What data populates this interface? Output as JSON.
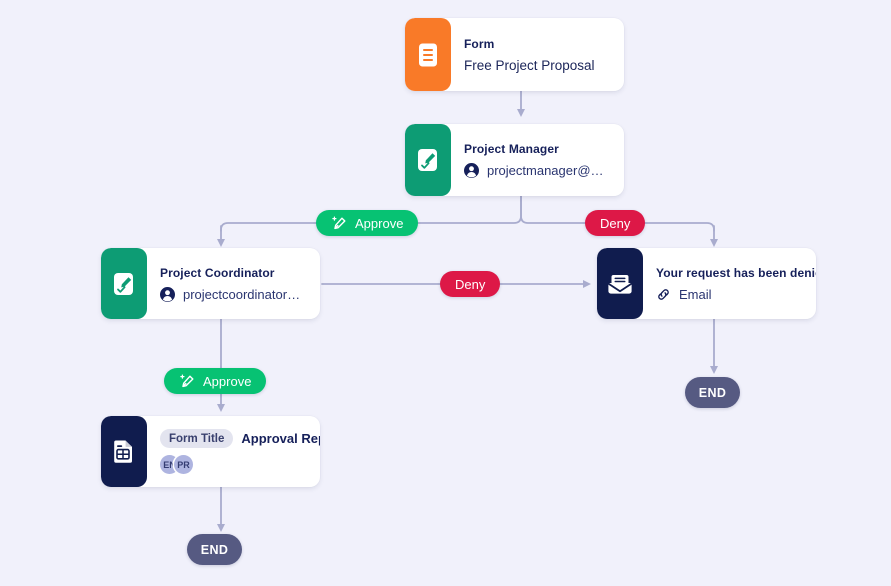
{
  "canvas": {
    "background_color": "#f1f1fb"
  },
  "palette": {
    "form_icon_bg": "#f97a28",
    "approver_icon_bg": "#0d9c74",
    "email_icon_bg": "#101c4e",
    "report_icon_bg": "#101c4e",
    "approve_pill_bg": "#07c273",
    "deny_pill_bg": "#dd1847",
    "end_pill_bg": "#565a82",
    "edge_stroke": "#a9acce",
    "card_bg": "#ffffff",
    "title_text": "#16205a",
    "lang_chip_bg": "#aeb4e0"
  },
  "nodes": {
    "form": {
      "icon": "document-icon",
      "title": "Form",
      "subtitle": "Free Project Proposal"
    },
    "project_manager": {
      "icon": "signature-approval-icon",
      "title": "Project Manager",
      "avatar_icon": "user-avatar-icon",
      "email": "projectmanager@exa..."
    },
    "project_coordinator": {
      "icon": "signature-approval-icon",
      "title": "Project Coordinator",
      "avatar_icon": "user-avatar-icon",
      "email": "projectcoordinator@e..."
    },
    "denied_email": {
      "icon": "envelope-icon",
      "title": "Your request has been denied.",
      "channel_icon": "link-icon",
      "channel": "Email"
    },
    "approval_report": {
      "icon": "report-document-icon",
      "tag_label": "Form Title",
      "title": "Approval Report",
      "languages": [
        "EN",
        "PR"
      ]
    }
  },
  "edge_labels": {
    "pm_approve": "Approve",
    "pm_deny": "Deny",
    "coordinator_deny": "Deny",
    "coordinator_approve": "Approve"
  },
  "terminators": {
    "end_report": "END",
    "end_denied": "END"
  }
}
